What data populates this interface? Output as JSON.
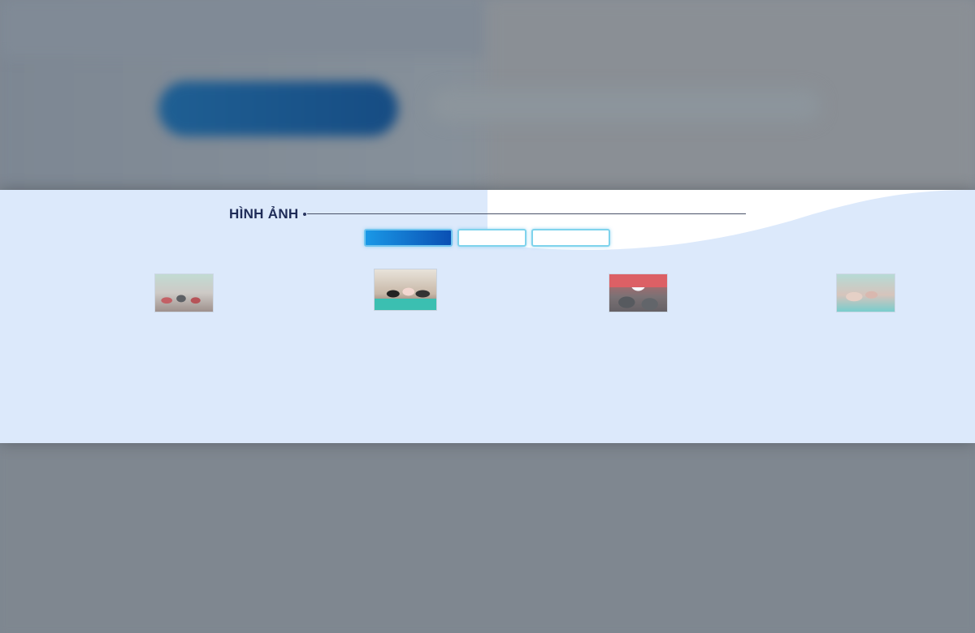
{
  "section": {
    "title": "HÌNH ẢNH"
  },
  "tabs": [
    {
      "label": "",
      "active": true
    },
    {
      "label": "",
      "active": false
    },
    {
      "label": "",
      "active": false
    }
  ],
  "gallery": {
    "thumbnails": [
      {
        "alt": ""
      },
      {
        "alt": ""
      },
      {
        "alt": ""
      },
      {
        "alt": ""
      }
    ]
  },
  "colors": {
    "modal_bg": "#dce9fb",
    "title_text": "#1f2c57",
    "tab_active_start": "#1a98e6",
    "tab_active_end": "#0a4fb3",
    "tab_border": "#7fd3ec",
    "overlay": "#7e8791"
  }
}
